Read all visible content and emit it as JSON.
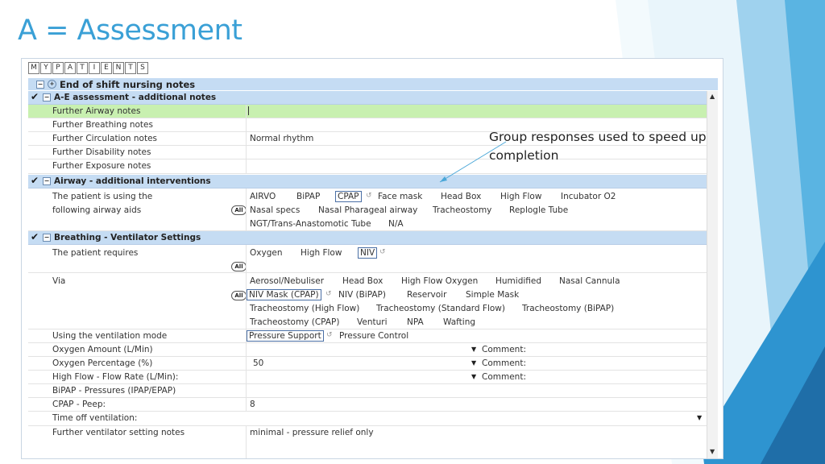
{
  "slide": {
    "title": "A = Assessment",
    "annotation": "Group responses used to speed up completion"
  },
  "app": {
    "logo_letters": [
      "M",
      "Y",
      "P",
      "A",
      "T",
      "I",
      "E",
      "N",
      "T",
      "S"
    ],
    "shift_header": "End of shift nursing notes"
  },
  "sections": {
    "ae": {
      "title": "A-E assessment - additional notes",
      "rows": [
        {
          "label": "Further Airway notes",
          "value": ""
        },
        {
          "label": "Further Breathing notes",
          "value": ""
        },
        {
          "label": "Further Circulation notes",
          "value": "Normal rhythm"
        },
        {
          "label": "Further Disability notes",
          "value": ""
        },
        {
          "label": "Further Exposure notes",
          "value": ""
        }
      ]
    },
    "airway": {
      "title": "Airway - additional interventions",
      "label_line1": "The patient is using the",
      "label_line2": "following airway aids",
      "all_label": "All",
      "options_row1": [
        "AIRVO",
        "BiPAP",
        "CPAP",
        "Face mask",
        "Head Box",
        "High Flow",
        "Incubator O2"
      ],
      "options_row2": [
        "Nasal specs",
        "Nasal Pharageal airway",
        "Tracheostomy",
        "Replogle Tube"
      ],
      "options_row3": [
        "NGT/Trans-Anastomotic Tube",
        "N/A"
      ],
      "selected": "CPAP"
    },
    "breathing": {
      "title": "Breathing - Ventilator Settings",
      "requires_label": "The patient requires",
      "requires_options": [
        "Oxygen",
        "High Flow",
        "NIV"
      ],
      "requires_selected": "NIV",
      "all_label": "All",
      "via_label": "Via",
      "via_row1": [
        "Aerosol/Nebuliser",
        "Head Box",
        "High Flow Oxygen",
        "Humidified",
        "Nasal Cannula"
      ],
      "via_row2": [
        "NIV Mask (CPAP)",
        "NIV (BiPAP)",
        "Reservoir",
        "Simple Mask"
      ],
      "via_row3": [
        "Tracheostomy (High Flow)",
        "Tracheostomy (Standard Flow)",
        "Tracheostomy (BiPAP)"
      ],
      "via_row4": [
        "Tracheostomy (CPAP)",
        "Venturi",
        "NPA",
        "Wafting"
      ],
      "via_selected": "NIV Mask (CPAP)",
      "mode_label": "Using the ventilation mode",
      "mode_options": [
        "Pressure Support",
        "Pressure Control"
      ],
      "mode_selected": "Pressure Support",
      "oxygen_amount_label": "Oxygen Amount (L/Min)",
      "oxygen_amount_value": "",
      "oxygen_pct_label": "Oxygen Percentage (%)",
      "oxygen_pct_value": "50",
      "flow_rate_label": "High Flow  - Flow Rate (L/Min):",
      "flow_rate_value": "",
      "comment_label": "Comment:",
      "bipap_label": "BiPAP - Pressures (IPAP/EPAP)",
      "bipap_value": "",
      "cpap_label": "CPAP - Peep:",
      "cpap_value": "8",
      "time_off_label": "Time off ventilation:",
      "time_off_value": "",
      "further_label": "Further ventilator setting notes",
      "further_value": "minimal - pressure relief only"
    }
  },
  "colors": {
    "title": "#3aa0d6",
    "section_header": "#c5dcf3",
    "active_row": "#c8f0b0"
  }
}
